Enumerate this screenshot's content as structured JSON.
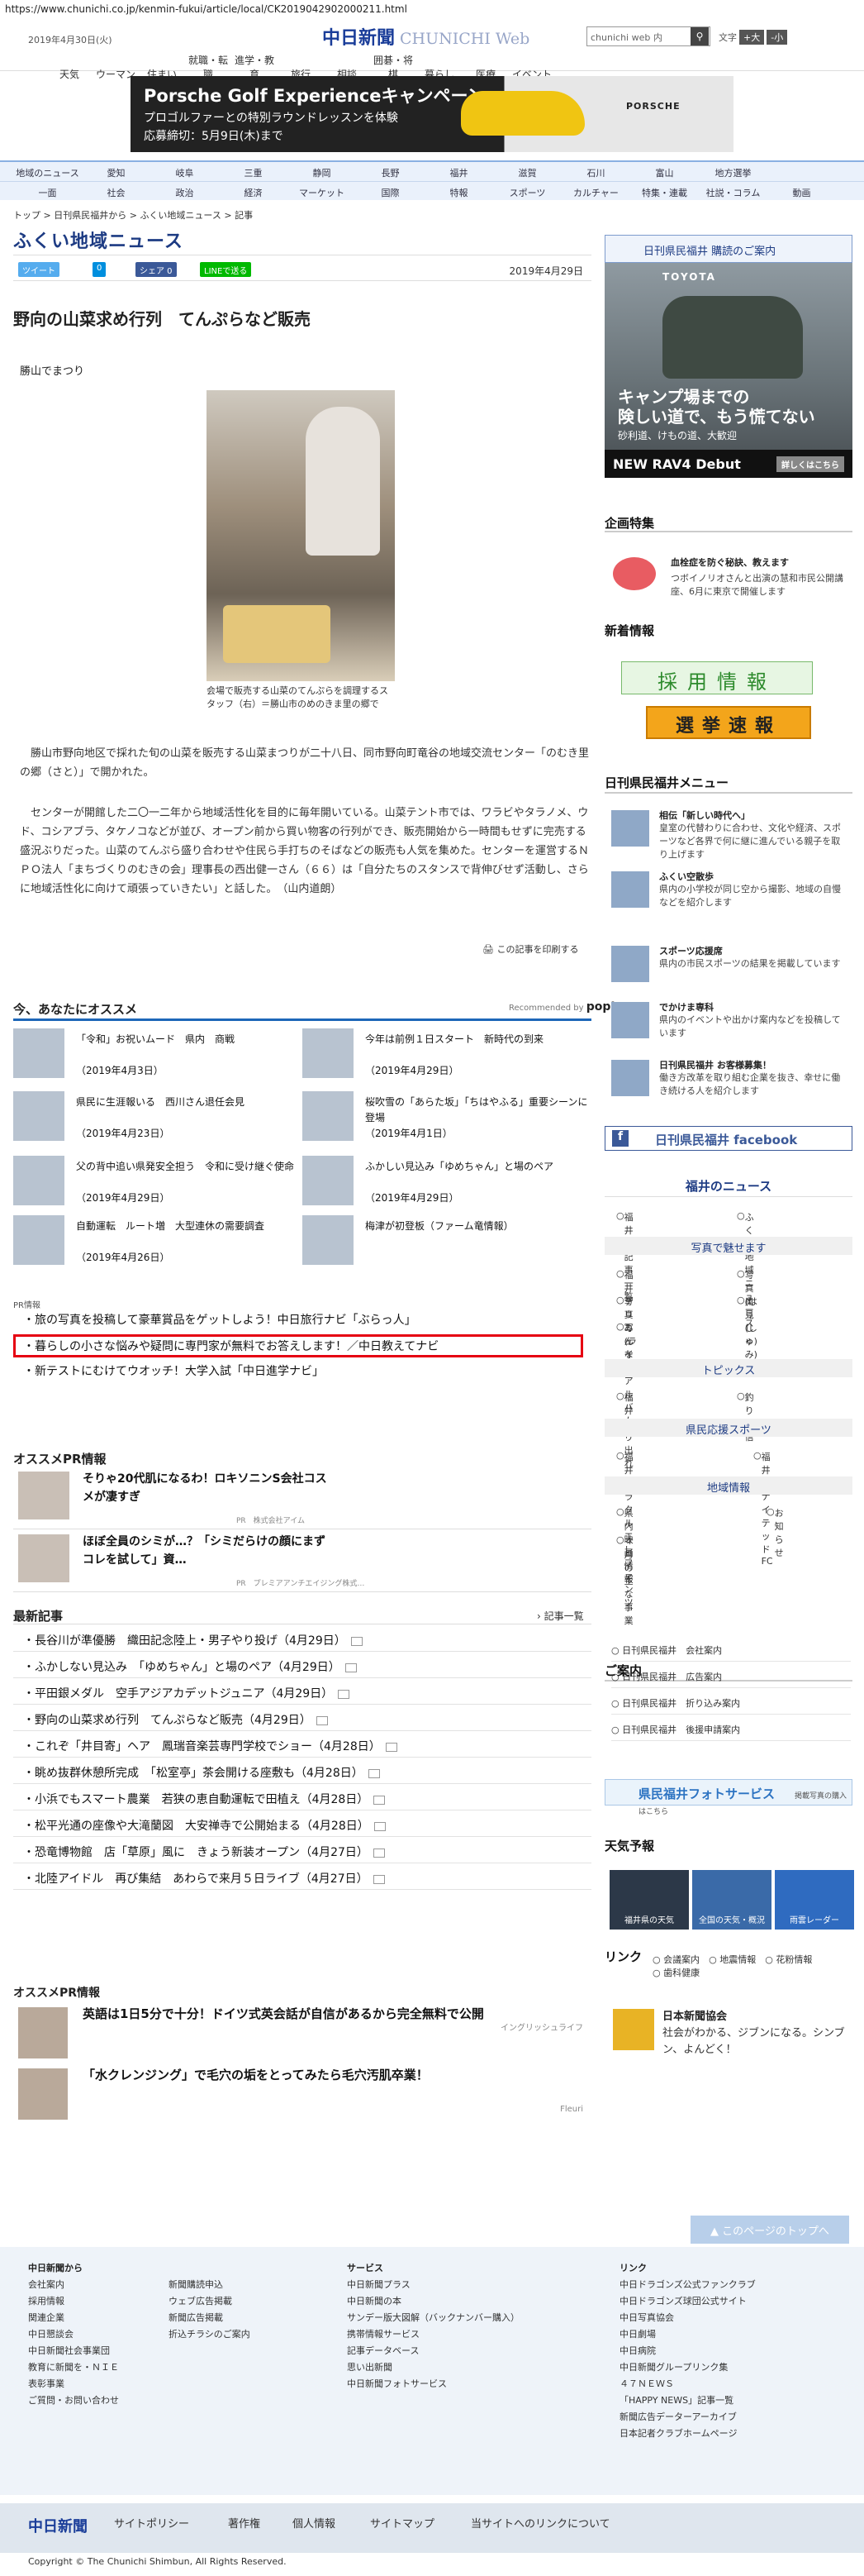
{
  "url": "https://www.chunichi.co.jp/kenmin-fukui/article/local/CK2019042902000211.html",
  "top": {
    "date": "2019年4月30日(火)",
    "logo": "中日新聞",
    "logo_en": "CHUNICHI Web",
    "search_placeholder": "chunichi web 内",
    "font_label": "文字",
    "font_big": "+大",
    "font_small": "-小"
  },
  "gnav": [
    "天気",
    "ウーマン",
    "住まい",
    "就職・転職",
    "進学・教育",
    "旅行",
    "相談",
    "囲碁・将棋",
    "暮らし",
    "医療",
    "イベント"
  ],
  "banner": {
    "title": "Porsche Golf Experienceキャンペーン",
    "line2": "プロゴルファーとの特別ラウンドレッスンを体験",
    "line3": "応募締切：5月9日(木)まで",
    "brand": "PORSCHE"
  },
  "nav_row1": [
    "地域のニュース",
    "愛知",
    "岐阜",
    "三重",
    "静岡",
    "長野",
    "福井",
    "滋賀",
    "石川",
    "富山",
    "地方選挙"
  ],
  "nav_row2": [
    "一面",
    "社会",
    "政治",
    "経済",
    "マーケット",
    "国際",
    "特報",
    "スポーツ",
    "カルチャー",
    "特集・連載",
    "社説・コラム",
    "動画"
  ],
  "breadcrumb": "トップ > 日刊県民福井から > ふくい地域ニュース > 記事",
  "page_title": "ふくい地域ニュース",
  "share": {
    "tweet": "ツイート",
    "b": "0",
    "fb": "シェア 0",
    "line": "LINEで送る"
  },
  "article": {
    "date": "2019年4月29日",
    "headline": "野向の山菜求め行列　てんぷらなど販売",
    "subhead": "勝山でまつり",
    "caption": "会場で販売する山菜のてんぷらを調理するスタッフ（右）＝勝山市のめのきま里の郷で",
    "p1": "　勝山市野向地区で採れた旬の山菜を販売する山菜まつりが二十八日、同市野向町竜谷の地域交流センター「のむき里の郷（さと）」で開かれた。",
    "p2": "　センターが開館した二〇一二年から地域活性化を目的に毎年開いている。山菜テント市では、ワラビやタラノメ、ウド、コシアブラ、タケノコなどが並び、オープン前から買い物客の行列ができ、販売開始から一時間もせずに完売する盛況ぶりだった。山菜のてんぷら盛り合わせや住民ら手打ちのそばなどの販売も人気を集めた。センターを運営するＮＰＯ法人「まちづくりのむきの会」理事長の西出健一さん（６６）は「自分たちのスタンスで背伸びせず活動し、さらに地域活性化に向けて頑張っていきたい」と話した。　（山内道朗）",
    "print": "この記事を印刷する"
  },
  "reco": {
    "heading": "今、あなたにオススメ",
    "by": "Recommended by",
    "brand": "popIn",
    "items": [
      {
        "title": "「令和」お祝いムード　県内　商戦",
        "date": "（2019年4月3日）"
      },
      {
        "title": "今年は前例１日スタート　新時代の到来",
        "date": "（2019年4月29日）"
      },
      {
        "title": "県民に生涯報いる　西川さん退任会見",
        "date": "（2019年4月23日）"
      },
      {
        "title": "桜吹雪の「あらた坂」「ちはやふる」重要シーンに登場",
        "date": "（2019年4月1日）"
      },
      {
        "title": "父の背中追い県発安全担う　令和に受け継ぐ使命",
        "date": "（2019年4月29日）"
      },
      {
        "title": "ふかしい見込み「ゆめちゃん」と場のペア",
        "date": "（2019年4月29日）"
      },
      {
        "title": "自動運転　ルート増　大型連休の需要調査",
        "date": "（2019年4月26日）"
      },
      {
        "title": "梅津が初登板（ファーム竜情報）",
        "date": ""
      }
    ]
  },
  "pr_label": "PR情報",
  "pr_links": [
    "旅の写真を投稿して豪華賞品をゲットしよう！中日旅行ナビ「ぶらっ人」",
    "暮らしの小さな悩みや疑問に専門家が無料でお答えします！／中日教えてナビ",
    "新テストにむけてウオッチ！大学入試「中日進学ナビ」"
  ],
  "osusume_pr": {
    "heading": "オススメPR情報",
    "items": [
      {
        "title": "そりゃ20代肌になるわ！ロキソニンS会社コスメが凄すぎ",
        "sponsor": "PR　株式会社アイム"
      },
      {
        "title": "ほぼ全員のシミが…？「シミだらけの顔にまずコレを試して」資…",
        "sponsor": "PR　プレミアアンチエイジング株式…"
      }
    ]
  },
  "latest": {
    "heading": "最新記事",
    "all": "記事一覧",
    "items": [
      "長谷川が準優勝　織田記念陸上・男子やり投げ（4月29日）",
      "ふかしない見込み　「ゆめちゃん」と場のペア（4月29日）",
      "平田銀メダル　空手アジアカデットジュニア（4月29日）",
      "野向の山菜求め行列　てんぷらなど販売（4月29日）",
      "これぞ「井目寄」ヘア　鳳瑞音楽芸専門学校でショー（4月28日）",
      "眺め抜群休憩所完成　「松室亭」茶会開ける座敷も（4月28日）",
      "小浜でもスマート農業　若狭の恵自動運転で田植え（4月28日）",
      "松平光通の座像や大滝蘭図　大安禅寺で公開始まる（4月28日）",
      "恐竜博物館　店「草原」風に　きょう新装オープン（4月27日）",
      "北陸アイドル　再び集結　あわらで来月５日ライブ（4月27日）"
    ]
  },
  "pr_bottom": {
    "heading": "オススメPR情報",
    "items": [
      {
        "title": "英語は1日5分で十分！ドイツ式英会話が自信があるから完全無料で公開",
        "sponsor": "イングリッシュライフ"
      },
      {
        "title": "「水クレンジング」で毛穴の垢をとってみたら毛穴汚肌卒業！",
        "sponsor": "Fleuri"
      }
    ]
  },
  "side": {
    "banner": "日刊県民福井 購読のご案内",
    "toyota": {
      "brand": "TOYOTA",
      "t1": "キャンプ場までの",
      "t1b": "険しい道で、もう慌てない",
      "t2": "砂利道、けもの道、大歓迎",
      "t3": "NEW RAV4 Debut",
      "more": "詳しくはこちら"
    },
    "kikaku_h": "企画特集",
    "kikaku_t": "血栓症を防ぐ秘訣、教えます",
    "kikaku_d": "つボイノリオさんと出演の慧和市民公開講座、6月に東京で開催します",
    "shinchaku": "新着情報",
    "saiyo": "採用情報",
    "senkyo": "選挙速報",
    "menu_h": "日刊県民福井メニュー",
    "menu": [
      {
        "t": "相伝「新しい時代へ」",
        "d": "皇室の代替わりに合わせ、文化や経済、スポーツなど各界で何に継に進んでいる親子を取り上げます"
      },
      {
        "t": "ふくい空散歩",
        "d": "県内の小学校が同じ空から撮影、地域の自慢などを紹介します"
      },
      {
        "t": "スポーツ応援席",
        "d": "県内の市民スポーツの結果を掲載しています"
      },
      {
        "t": "でかけま専科",
        "d": "県内のイベントや出かけ案内などを投稿しています"
      },
      {
        "t": "日刊県民福井 お客様募集！",
        "d": "働き方改革を取り組む企業を抜き、幸せに働き続ける人を紹介します"
      }
    ],
    "fb": "日刊県民福井 facebook",
    "fukui_h": "福井のニュース",
    "fukui1": [
      "福井発 記事一覧",
      "ふくい地域ニュース"
    ],
    "photo_h": "写真で魅せます",
    "photo": [
      "福井写真ニュース",
      "写真(はっしゃ)",
      "デリ写(ライフ)",
      "奥見(しゅみ)",
      "みんなのアルバム"
    ],
    "topics_h": "トピックス",
    "topics": [
      "福井撮り出れ",
      "釣り通信"
    ],
    "sports_h": "県民応援スポーツ",
    "sports": [
      "福井ミラクルエレファンツ",
      "福井ユナイテッドFC"
    ],
    "area_h": "地域情報",
    "area": [
      "県内映画情報",
      "お知らせ",
      "４月の主な事業"
    ],
    "annai_h": "ご案内",
    "annai": [
      "日刊県民福井　会社案内",
      "日刊県民福井　広告案内",
      "日刊県民福井　折り込み案内",
      "日刊県民福井　後援申請案内"
    ],
    "photosv": "県民福井フォトサービス",
    "photosv2": "掲載写真の購入はこちら",
    "tenki_h": "天気予報",
    "tenki": [
      "福井県の天気",
      "全国の天気・概況",
      "雨雲レーダー"
    ],
    "link_h": "リンク",
    "links": [
      "会議案内",
      "地震情報",
      "花粉情報",
      "歯科健康"
    ],
    "nihon_t": "日本新聞協会",
    "nihon_d": "社会がわかる、ジブンになる。シンブン、よんどく！"
  },
  "totop": "このページのトップへ",
  "footer": {
    "c1h": "中日新聞から",
    "c1": [
      "会社案内",
      "採用情報",
      "関連企業",
      "中日懇談会",
      "中日新聞社会事業団",
      "教育に新聞を・ＮＩＥ",
      "表彰事業",
      "ご質問・お問い合わせ"
    ],
    "c2": [
      "新聞購読申込",
      "ウェブ広告掲載",
      "新聞広告掲載",
      "折込チラシのご案内"
    ],
    "c3h": "サービス",
    "c3": [
      "中日新聞プラス",
      "中日新聞の本",
      "サンデー版大図解（バックナンバー購入）",
      "携帯情報サービス",
      "記事データベース",
      "思い出新聞",
      "中日新聞フォトサービス"
    ],
    "c4h": "リンク",
    "c4": [
      "中日ドラゴンズ公式ファンクラブ",
      "中日ドラゴンズ球団公式サイト",
      "中日写真協会",
      "中日劇場",
      "中日病院",
      "中日新聞グループリンク集",
      "４７ＮＥＷＳ",
      "「HAPPY NEWS」記事一覧",
      "新聞広告データーアーカイブ",
      "日本記者クラブホームページ"
    ]
  },
  "bottom": {
    "logo": "中日新聞",
    "links": [
      "サイトポリシー",
      "著作権",
      "個人情報",
      "サイトマップ",
      "当サイトへのリンクについて"
    ],
    "copy": "Copyright © The Chunichi Shimbun, All Rights Reserved."
  }
}
